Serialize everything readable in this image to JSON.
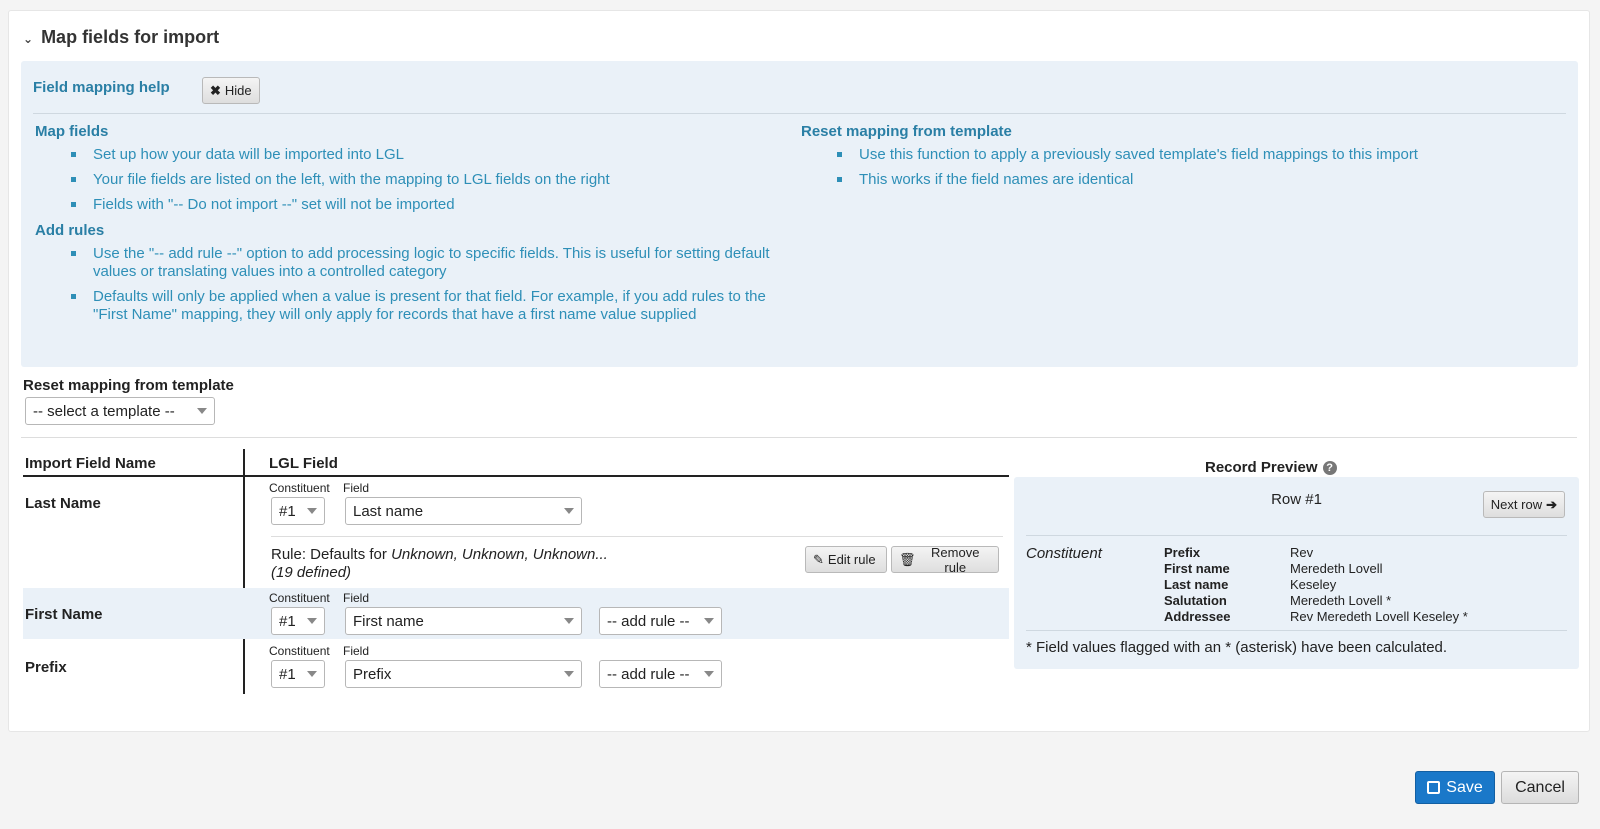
{
  "section": {
    "title": "Map fields for import"
  },
  "help": {
    "title": "Field mapping help",
    "hide_label": "Hide",
    "map_fields": {
      "heading": "Map fields",
      "items": [
        "Set up how your data will be imported into LGL",
        "Your file fields are listed on the left, with the mapping to LGL fields on the right",
        "Fields with \"-- Do not import --\" set will not be imported"
      ]
    },
    "add_rules": {
      "heading": "Add rules",
      "items": [
        "Use the \"-- add rule --\" option to add processing logic to specific fields. This is useful for setting default values or translating values into a controlled category",
        "Defaults will only be applied when a value is present for that field. For example, if you add rules to the \"First Name\" mapping, they will only apply for records that have a first name value supplied"
      ]
    },
    "reset_mapping": {
      "heading": "Reset mapping from template",
      "items": [
        "Use this function to apply a previously saved template's field mappings to this import",
        "This works if the field names are identical"
      ]
    }
  },
  "reset": {
    "label": "Reset mapping from template",
    "select_value": "-- select a template --"
  },
  "table": {
    "col_import": "Import Field Name",
    "col_lgl": "LGL Field",
    "constituent_label": "Constituent",
    "field_label": "Field",
    "rows": [
      {
        "name": "Last Name",
        "constituent": "#1",
        "field": "Last name"
      },
      {
        "name": "First Name",
        "constituent": "#1",
        "field": "First name",
        "rule_select": "-- add rule --"
      },
      {
        "name": "Prefix",
        "constituent": "#1",
        "field": "Prefix",
        "rule_select": "-- add rule --"
      }
    ],
    "rule": {
      "prefix": "Rule: Defaults for ",
      "values": "Unknown, Unknown, Unknown...",
      "count": "(19 defined)",
      "edit_label": "Edit rule",
      "remove_label": "Remove rule"
    }
  },
  "preview": {
    "title": "Record Preview",
    "row_label": "Row #1",
    "next_label": "Next row",
    "constituent": "Constituent",
    "fields": [
      {
        "key": "Prefix",
        "value": "Rev"
      },
      {
        "key": "First name",
        "value": "Meredeth Lovell"
      },
      {
        "key": "Last name",
        "value": "Keseley"
      },
      {
        "key": "Salutation",
        "value": "Meredeth Lovell *"
      },
      {
        "key": "Addressee",
        "value": "Rev Meredeth Lovell Keseley *"
      }
    ],
    "footnote": "* Field values flagged with an * (asterisk) have been calculated."
  },
  "footer": {
    "save_label": "Save",
    "cancel_label": "Cancel"
  },
  "colors": {
    "help_bg": "#eaf1f8",
    "help_text": "#2e8fb7",
    "primary": "#1a78c9"
  }
}
